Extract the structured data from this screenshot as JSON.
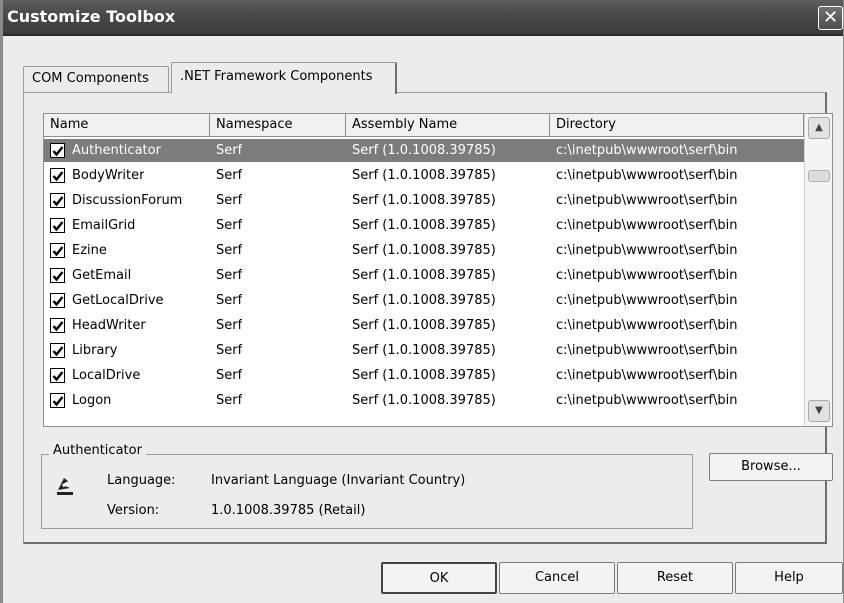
{
  "window": {
    "title": "Customize Toolbox",
    "close_glyph": "✕"
  },
  "tabs": [
    {
      "label": "COM Components"
    },
    {
      "label": ".NET Framework Components"
    }
  ],
  "list": {
    "columns": [
      "Name",
      "Namespace",
      "Assembly Name",
      "Directory"
    ],
    "rows": [
      {
        "checked": true,
        "name": "Authenticator",
        "namespace": "Serf",
        "assembly": "Serf (1.0.1008.39785)",
        "directory": "c:\\inetpub\\wwwroot\\serf\\bin"
      },
      {
        "checked": true,
        "name": "BodyWriter",
        "namespace": "Serf",
        "assembly": "Serf (1.0.1008.39785)",
        "directory": "c:\\inetpub\\wwwroot\\serf\\bin"
      },
      {
        "checked": true,
        "name": "DiscussionForum",
        "namespace": "Serf",
        "assembly": "Serf (1.0.1008.39785)",
        "directory": "c:\\inetpub\\wwwroot\\serf\\bin"
      },
      {
        "checked": true,
        "name": "EmailGrid",
        "namespace": "Serf",
        "assembly": "Serf (1.0.1008.39785)",
        "directory": "c:\\inetpub\\wwwroot\\serf\\bin"
      },
      {
        "checked": true,
        "name": "Ezine",
        "namespace": "Serf",
        "assembly": "Serf (1.0.1008.39785)",
        "directory": "c:\\inetpub\\wwwroot\\serf\\bin"
      },
      {
        "checked": true,
        "name": "GetEmail",
        "namespace": "Serf",
        "assembly": "Serf (1.0.1008.39785)",
        "directory": "c:\\inetpub\\wwwroot\\serf\\bin"
      },
      {
        "checked": true,
        "name": "GetLocalDrive",
        "namespace": "Serf",
        "assembly": "Serf (1.0.1008.39785)",
        "directory": "c:\\inetpub\\wwwroot\\serf\\bin"
      },
      {
        "checked": true,
        "name": "HeadWriter",
        "namespace": "Serf",
        "assembly": "Serf (1.0.1008.39785)",
        "directory": "c:\\inetpub\\wwwroot\\serf\\bin"
      },
      {
        "checked": true,
        "name": "Library",
        "namespace": "Serf",
        "assembly": "Serf (1.0.1008.39785)",
        "directory": "c:\\inetpub\\wwwroot\\serf\\bin"
      },
      {
        "checked": true,
        "name": "LocalDrive",
        "namespace": "Serf",
        "assembly": "Serf (1.0.1008.39785)",
        "directory": "c:\\inetpub\\wwwroot\\serf\\bin"
      },
      {
        "checked": true,
        "name": "Logon",
        "namespace": "Serf",
        "assembly": "Serf (1.0.1008.39785)",
        "directory": "c:\\inetpub\\wwwroot\\serf\\bin"
      }
    ],
    "selected_row": "Authenticator",
    "scroll_up_glyph": "▲",
    "scroll_down_glyph": "▼"
  },
  "details": {
    "legend": "Authenticator",
    "icon": "component-icon",
    "language_label": "Language:",
    "language_value": "Invariant Language (Invariant Country)",
    "version_label": "Version:",
    "version_value": "1.0.1008.39785 (Retail)"
  },
  "buttons": {
    "browse": "Browse...",
    "ok": "OK",
    "cancel": "Cancel",
    "reset": "Reset",
    "help": "Help"
  },
  "colors": {
    "title_bar": "#4a4a4a",
    "selected_row": "#7c7c7c",
    "dialog_bg": "#ececec"
  }
}
